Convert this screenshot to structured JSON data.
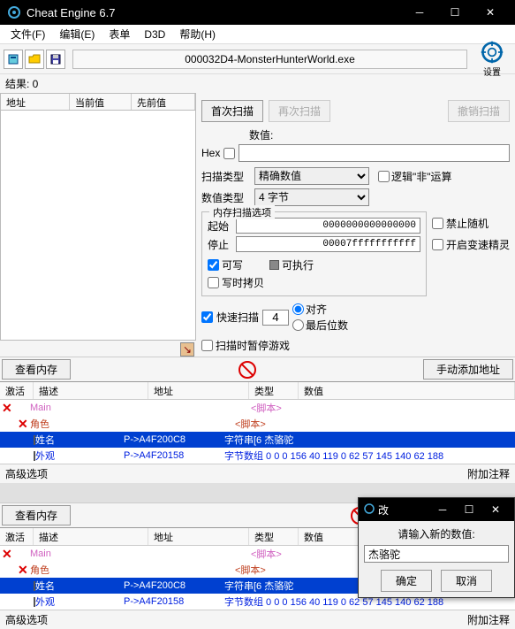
{
  "title": "Cheat Engine 6.7",
  "menu": {
    "file": "文件(F)",
    "edit": "编辑(E)",
    "table": "表单",
    "d3d": "D3D",
    "help": "帮助(H)"
  },
  "process_name": "000032D4-MonsterHunterWorld.exe",
  "settings_label": "设置",
  "results_label": "结果: 0",
  "result_cols": {
    "addr": "地址",
    "curval": "当前值",
    "prevval": "先前值"
  },
  "scan_buttons": {
    "first": "首次扫描",
    "next": "再次扫描",
    "undo": "撤销扫描"
  },
  "value_label": "数值:",
  "hex_label": "Hex",
  "scan_type_label": "扫描类型",
  "scan_type_value": "精确数值",
  "value_type_label": "数值类型",
  "value_type_value": "4 字节",
  "logic_not_label": "逻辑\"非\"运算",
  "mem_group": {
    "title": "内存扫描选项",
    "start_label": "起始",
    "start_value": "0000000000000000",
    "stop_label": "停止",
    "stop_value": "00007fffffffffff",
    "writable": "可写",
    "executable": "可执行",
    "cow": "写时拷贝"
  },
  "side_opts": {
    "no_random": "禁止随机",
    "speedhack": "开启变速精灵"
  },
  "fast_scan": {
    "label": "快速扫描",
    "value": "4",
    "aligned": "对齐",
    "last_digits": "最后位数"
  },
  "pause_label": "扫描时暂停游戏",
  "bottom_actions": {
    "view_mem": "查看内存",
    "manual_add": "手动添加地址"
  },
  "addr_cols": {
    "active": "激活",
    "desc": "描述",
    "addr": "地址",
    "type": "类型",
    "value": "数值"
  },
  "rows": {
    "main": "Main",
    "main_type": "<脚本>",
    "role": "角色",
    "role_type": "<脚本>",
    "name": "姓名",
    "name_addr": "P->A4F200C8",
    "name_type": "字符串[6 杰骆驼",
    "look": "外观",
    "look_addr": "P->A4F20158",
    "look_type": "字节数组 0 0 0 156 40 119 0 62 57 145 140 62 188"
  },
  "adv_options": "高级选项",
  "attach_note": "附加注释",
  "edit_dialog": {
    "title": "改",
    "prompt": "请输入新的数值:",
    "value": "杰骆驼",
    "ok": "确定",
    "cancel": "取消"
  }
}
